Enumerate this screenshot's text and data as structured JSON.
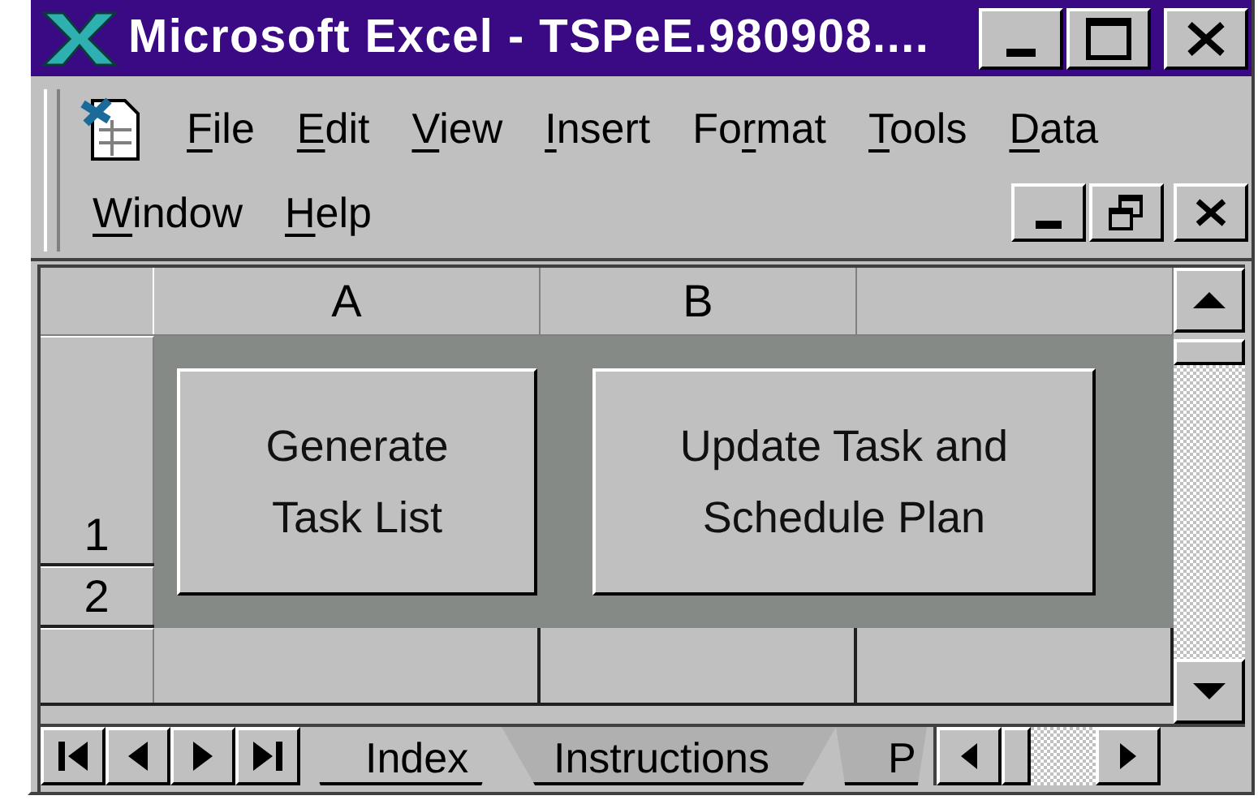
{
  "window": {
    "title": "Microsoft Excel - TSPeE.980908...."
  },
  "menu": [
    {
      "key": "F",
      "post": "ile"
    },
    {
      "key": "E",
      "post": "dit"
    },
    {
      "key": "V",
      "post": "iew"
    },
    {
      "key": "I",
      "post": "nsert"
    },
    {
      "pre": "Fo",
      "key": "r",
      "post": "mat"
    },
    {
      "key": "T",
      "post": "ools"
    },
    {
      "key": "D",
      "post": "ata"
    },
    {
      "key": "W",
      "post": "indow"
    },
    {
      "key": "H",
      "post": "elp"
    }
  ],
  "sheet": {
    "columns": [
      "A",
      "B"
    ],
    "rows": [
      "1",
      "2"
    ],
    "buttons": [
      {
        "label": "Generate Task List"
      },
      {
        "label": "Update Task and Schedule Plan"
      }
    ]
  },
  "sheet_tabs": [
    {
      "label": "Index",
      "selected": true
    },
    {
      "label": "Instructions",
      "selected": false
    },
    {
      "label": "P",
      "selected": false
    }
  ]
}
